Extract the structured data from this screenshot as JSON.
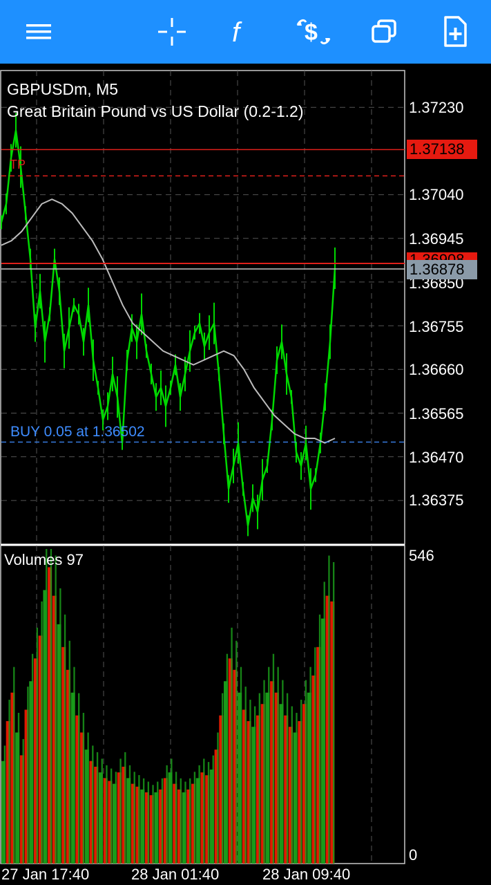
{
  "toolbar": {
    "menu_icon": "hamburger-menu-icon",
    "crosshair_icon": "crosshair-icon",
    "indicators_icon": "function-f-icon",
    "trade_icon": "dollar-trade-icon",
    "windows_icon": "windows-stack-icon",
    "new_order_icon": "document-add-icon"
  },
  "colors": {
    "toolbar_bg": "#1e90ff",
    "candle_up": "#00d800",
    "volume_up": "#1a9a1a",
    "volume_down": "#e01b00",
    "tp_line": "#e0201b",
    "current_price_tag": "#8a9aa8",
    "buy_label": "#3e8cff"
  },
  "chart": {
    "symbol_line": "GBPUSDm, M5",
    "description_line": "Great Britain Pound vs US Dollar (0.2-1.2)",
    "tp_marker": "TP",
    "order_label": "BUY 0.05 at 1.36502",
    "price_axis": [
      "1.37230",
      "1.37040",
      "1.36945",
      "1.36850",
      "1.36755",
      "1.36660",
      "1.36565",
      "1.36470",
      "1.36375"
    ],
    "tp_price_tag": "1.37138",
    "hidden_price_tag": "1.36908",
    "current_price_tag": "1.36878"
  },
  "volumes": {
    "label": "Volumes 97",
    "axis_max": "546",
    "axis_min": "0"
  },
  "time_axis": [
    "27 Jan 17:40",
    "28 Jan 01:40",
    "28 Jan 09:40"
  ],
  "chart_data": {
    "type": "line",
    "title": "GBPUSDm, M5",
    "subtitle": "Great Britain Pound vs US Dollar (0.2-1.2)",
    "ylim": [
      1.3628,
      1.3731
    ],
    "close_series_approx": [
      1.3698,
      1.3702,
      1.3712,
      1.3718,
      1.371,
      1.37,
      1.369,
      1.3675,
      1.3683,
      1.3672,
      1.3678,
      1.369,
      1.3683,
      1.367,
      1.3675,
      1.368,
      1.3678,
      1.3672,
      1.368,
      1.3668,
      1.3662,
      1.3655,
      1.3658,
      1.3665,
      1.366,
      1.365,
      1.3668,
      1.3675,
      1.3672,
      1.3678,
      1.367,
      1.3665,
      1.366,
      1.3662,
      1.3658,
      1.3662,
      1.3667,
      1.366,
      1.3665,
      1.367,
      1.3674,
      1.3676,
      1.3671,
      1.3674,
      1.3676,
      1.3665,
      1.3652,
      1.364,
      1.3645,
      1.365,
      1.364,
      1.3632,
      1.3638,
      1.3635,
      1.3642,
      1.3645,
      1.3655,
      1.3668,
      1.3672,
      1.3665,
      1.366,
      1.3648,
      1.3645,
      1.365,
      1.364,
      1.3643,
      1.365,
      1.366,
      1.3672,
      1.3688
    ],
    "moving_average_approx": [
      1.3693,
      1.3694,
      1.3696,
      1.3699,
      1.3702,
      1.3703,
      1.3702,
      1.37,
      1.3697,
      1.3694,
      1.369,
      1.3685,
      1.368,
      1.3676,
      1.3674,
      1.3672,
      1.367,
      1.3669,
      1.3668,
      1.3667,
      1.3668,
      1.3669,
      1.367,
      1.3669,
      1.3666,
      1.3662,
      1.3659,
      1.3656,
      1.3654,
      1.3652,
      1.3651,
      1.3651,
      1.365,
      1.3651
    ],
    "volume_series_approx": [
      180,
      250,
      300,
      230,
      190,
      270,
      320,
      360,
      400,
      480,
      520,
      470,
      420,
      380,
      340,
      300,
      260,
      230,
      200,
      180,
      170,
      160,
      150,
      145,
      140,
      160,
      170,
      150,
      140,
      135,
      130,
      125,
      120,
      125,
      130,
      150,
      160,
      140,
      130,
      125,
      130,
      140,
      150,
      160,
      155,
      165,
      200,
      260,
      320,
      360,
      340,
      300,
      270,
      250,
      240,
      260,
      280,
      300,
      320,
      300,
      280,
      260,
      240,
      230,
      250,
      280,
      300,
      330,
      380,
      430,
      470,
      460
    ],
    "volume_ylim": [
      0,
      546
    ],
    "orders": [
      {
        "type": "BUY",
        "lots": 0.05,
        "price": 1.36502
      },
      {
        "type": "TP",
        "price": 1.37138
      }
    ],
    "current_price": 1.36878
  }
}
